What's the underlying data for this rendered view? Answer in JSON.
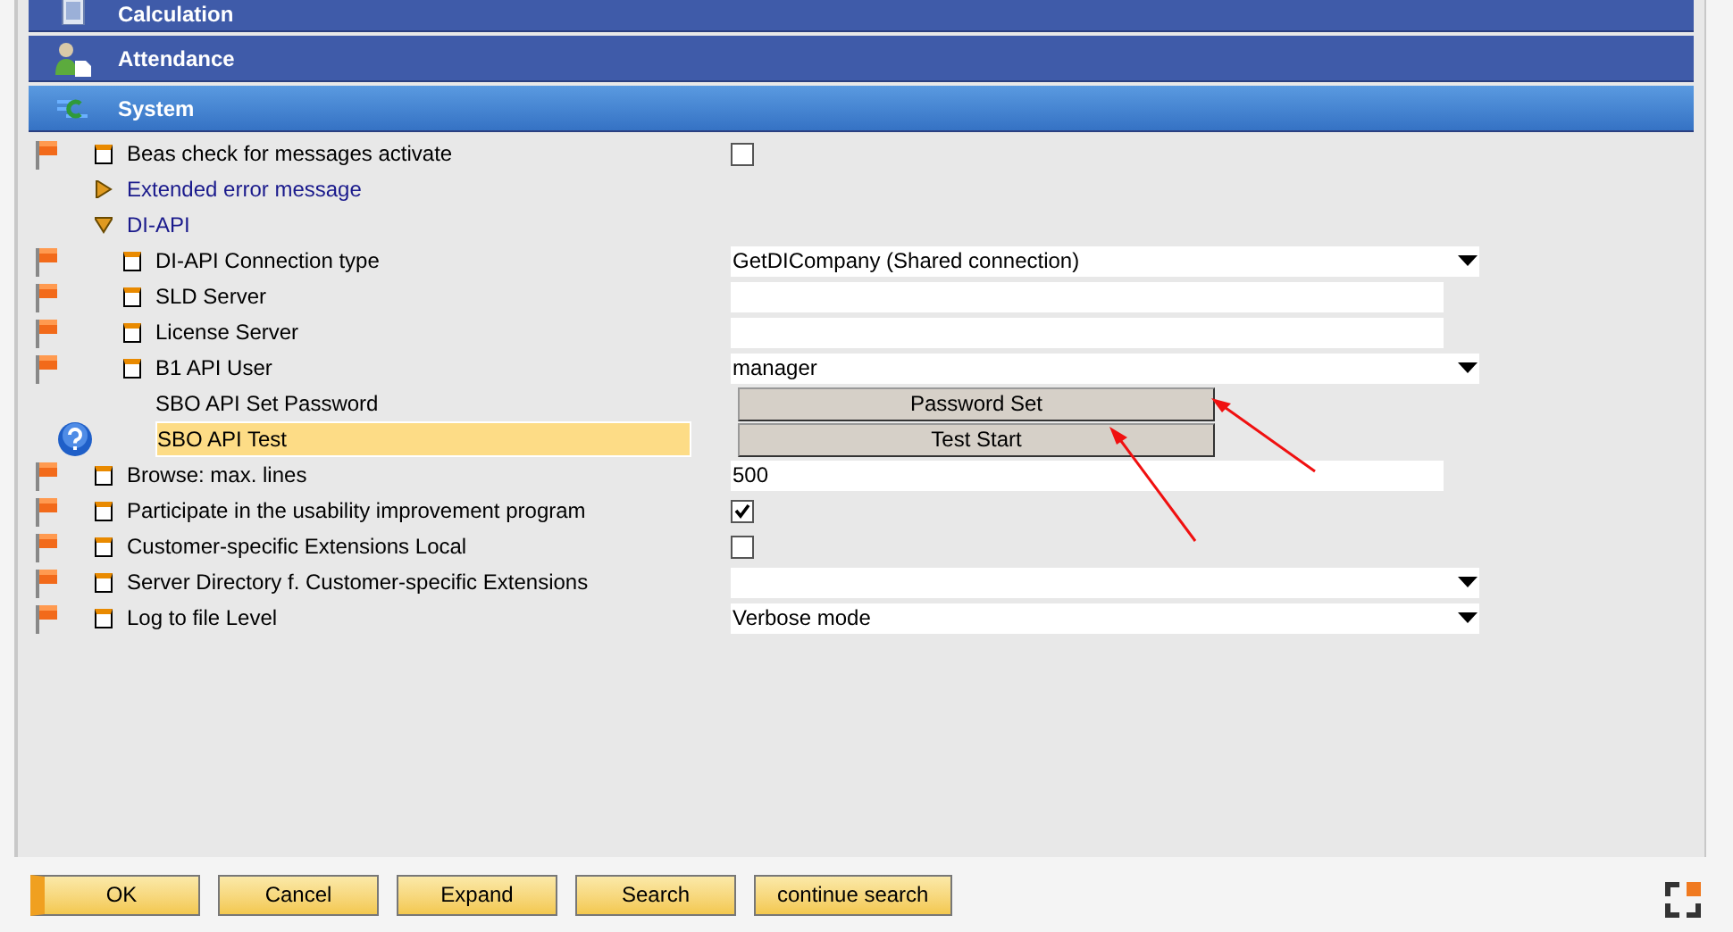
{
  "sections": [
    {
      "title": "Calculation",
      "kind": "calculator",
      "active": false
    },
    {
      "title": "Attendance",
      "kind": "person",
      "active": false
    },
    {
      "title": "System",
      "kind": "system",
      "active": true
    }
  ],
  "rows": [
    {
      "kind": "setting",
      "label": "Beas check for messages activate",
      "flagged": true,
      "help": false,
      "bullet": true,
      "selected": false,
      "control": {
        "kind": "checkbox",
        "checked": false
      }
    },
    {
      "kind": "group",
      "label": "Extended error message",
      "expanded": false
    },
    {
      "kind": "group",
      "label": "DI-API",
      "expanded": true,
      "children": [
        {
          "kind": "setting",
          "label": "DI-API Connection type",
          "flagged": true,
          "help": false,
          "bullet": true,
          "selected": false,
          "control": {
            "kind": "dropdown",
            "value": "GetDICompany (Shared connection)"
          }
        },
        {
          "kind": "setting",
          "label": "SLD Server",
          "flagged": true,
          "help": false,
          "bullet": true,
          "selected": false,
          "control": {
            "kind": "text"
          }
        },
        {
          "kind": "setting",
          "label": "License Server",
          "flagged": true,
          "help": false,
          "bullet": true,
          "selected": false,
          "control": {
            "kind": "text"
          }
        },
        {
          "kind": "setting",
          "label": "B1 API User",
          "flagged": true,
          "help": false,
          "bullet": true,
          "selected": false,
          "control": {
            "kind": "dropdown",
            "value": "manager"
          }
        },
        {
          "kind": "setting",
          "label": "SBO API Set Password",
          "flagged": false,
          "help": false,
          "bullet": false,
          "selected": false,
          "control": {
            "kind": "button",
            "value": "Password Set"
          }
        },
        {
          "kind": "setting",
          "label": "SBO API Test",
          "flagged": false,
          "help": true,
          "bullet": false,
          "selected": true,
          "control": {
            "kind": "button",
            "value": "Test Start"
          }
        }
      ]
    },
    {
      "kind": "setting",
      "label": "Browse: max. lines",
      "flagged": true,
      "help": false,
      "bullet": true,
      "selected": false,
      "control": {
        "kind": "text",
        "value": "500"
      }
    },
    {
      "kind": "setting",
      "label": "Participate in the usability improvement program",
      "flagged": true,
      "help": false,
      "bullet": true,
      "selected": false,
      "control": {
        "kind": "checkbox",
        "checked": true
      }
    },
    {
      "kind": "setting",
      "label": "Customer-specific Extensions Local",
      "flagged": true,
      "help": false,
      "bullet": true,
      "selected": false,
      "control": {
        "kind": "checkbox",
        "checked": false
      }
    },
    {
      "kind": "setting",
      "label": "Server Directory f. Customer-specific Extensions",
      "flagged": true,
      "help": false,
      "bullet": true,
      "selected": false,
      "control": {
        "kind": "dropdown"
      }
    },
    {
      "kind": "setting",
      "label": "Log to file Level",
      "flagged": true,
      "help": false,
      "bullet": true,
      "selected": false,
      "control": {
        "kind": "dropdown",
        "value": "Verbose mode"
      }
    }
  ],
  "buttons": [
    {
      "label": "OK",
      "default": true
    },
    {
      "label": "Cancel",
      "default": false
    },
    {
      "label": "Expand",
      "default": false
    },
    {
      "label": "Search",
      "default": false
    },
    {
      "label": "continue search",
      "default": false
    }
  ]
}
